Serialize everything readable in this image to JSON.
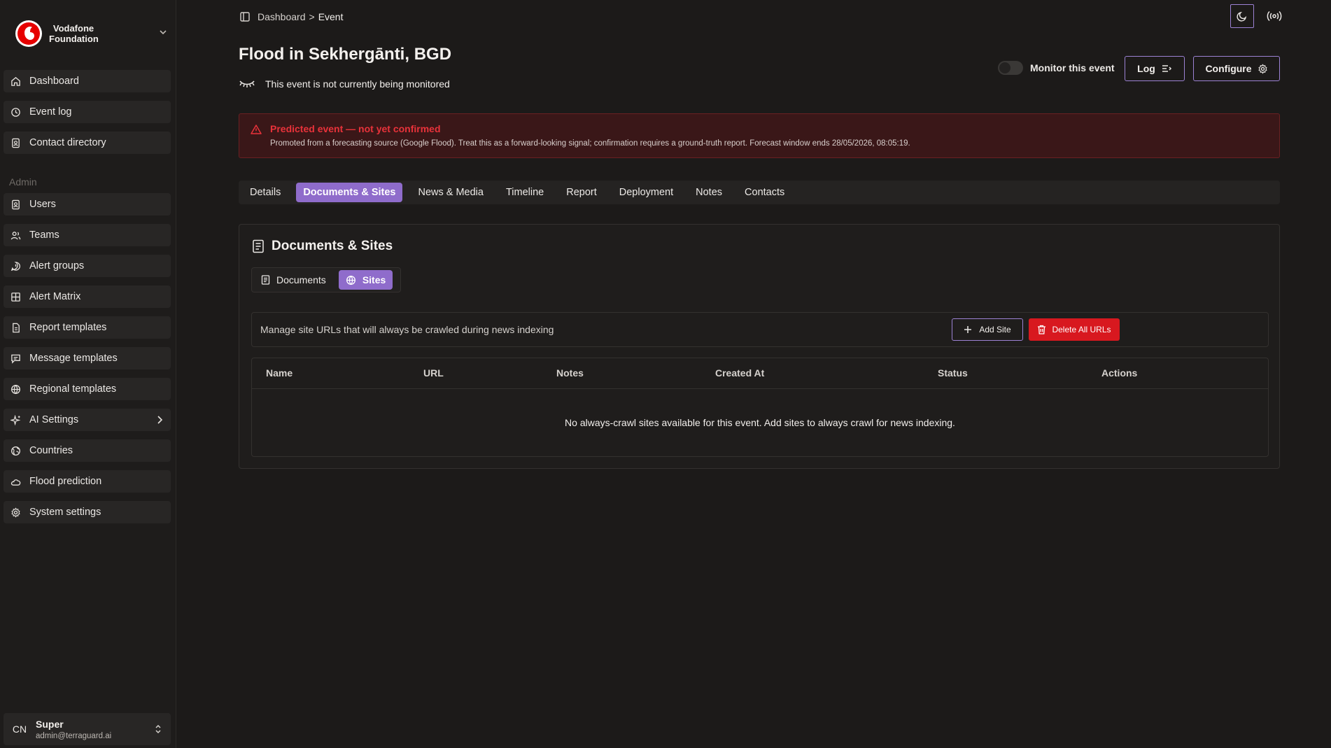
{
  "brand": {
    "line1": "Vodafone",
    "line2": "Foundation"
  },
  "nav": {
    "main": [
      {
        "label": "Dashboard",
        "icon": "home-icon"
      },
      {
        "label": "Event log",
        "icon": "history-icon"
      },
      {
        "label": "Contact directory",
        "icon": "contacts-icon"
      }
    ],
    "section_label": "Admin",
    "admin": [
      {
        "label": "Users",
        "icon": "users-icon"
      },
      {
        "label": "Teams",
        "icon": "teams-icon"
      },
      {
        "label": "Alert groups",
        "icon": "alert-groups-icon"
      },
      {
        "label": "Alert Matrix",
        "icon": "alert-matrix-icon"
      },
      {
        "label": "Report templates",
        "icon": "report-icon"
      },
      {
        "label": "Message templates",
        "icon": "message-icon"
      },
      {
        "label": "Regional templates",
        "icon": "globe-icon"
      },
      {
        "label": "AI Settings",
        "icon": "sparkles-icon"
      },
      {
        "label": "Countries",
        "icon": "earth-icon"
      },
      {
        "label": "Flood prediction",
        "icon": "cloud-icon"
      },
      {
        "label": "System settings",
        "icon": "gear-icon"
      }
    ]
  },
  "user": {
    "initials": "CN",
    "name": "Super",
    "email": "admin@terraguard.ai"
  },
  "breadcrumb": {
    "root": "Dashboard",
    "separator": ">",
    "current": "Event"
  },
  "event": {
    "title": "Flood in Sekhergānti, BGD",
    "monitor_status": "This event is not currently being monitored",
    "monitor_toggle_label": "Monitor this event",
    "monitor_on": false,
    "log_label": "Log",
    "configure_label": "Configure"
  },
  "alert": {
    "title": "Predicted event — not yet confirmed",
    "text": "Promoted from a forecasting source (Google Flood). Treat this as a forward-looking signal; confirmation requires a ground-truth report. Forecast window ends 28/05/2026, 08:05:19."
  },
  "tabs": [
    "Details",
    "Documents & Sites",
    "News & Media",
    "Timeline",
    "Report",
    "Deployment",
    "Notes",
    "Contacts"
  ],
  "active_tab": "Documents & Sites",
  "card": {
    "title": "Documents & Sites",
    "segments": [
      "Documents",
      "Sites"
    ],
    "active_segment": "Sites",
    "description": "Manage site URLs that will always be crawled during news indexing",
    "add_label": "Add Site",
    "delete_label": "Delete All URLs"
  },
  "table": {
    "columns": [
      "Name",
      "URL",
      "Notes",
      "Created At",
      "Status",
      "Actions"
    ],
    "empty_message": "No always-crawl sites available for this event. Add sites to always crawl for news indexing."
  },
  "colors": {
    "accent": "#8f6ccb",
    "accent_border": "#9c82d4",
    "danger": "#d8181f",
    "alert_text": "#e9323a",
    "background": "#1c1a19"
  }
}
